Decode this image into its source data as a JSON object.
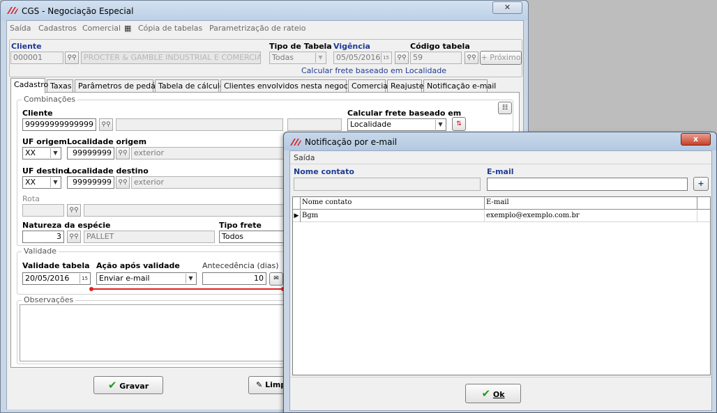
{
  "main_window": {
    "title": "CGS - Negociação Especial",
    "menu": [
      "Saída",
      "Cadastros",
      "Comercial",
      "Cópia de tabelas",
      "Parametrização de rateio"
    ],
    "header": {
      "cliente_label": "Cliente",
      "cliente_code": "000001",
      "cliente_name": "PROCTER & GAMBLE INDUSTRIAL E COMERCIAL LTDA",
      "tipo_tabela_label": "Tipo de Tabela",
      "tipo_tabela_value": "Todas",
      "vigencia_label": "Vigência",
      "vigencia_value": "05/05/2016",
      "codigo_tabela_label": "Código tabela",
      "codigo_tabela_value": "59",
      "proximo_label": "Próximo",
      "info_text": "Calcular frete baseado em Localidade"
    },
    "tabs": [
      "Cadastro",
      "Taxas",
      "Parâmetros de pedágio",
      "Tabela de cálculo",
      "Clientes envolvidos nesta negociação",
      "Comercial",
      "Reajuste",
      "Notificação e-mail"
    ],
    "combinacoes": {
      "title": "Combinações",
      "cliente_label": "Cliente",
      "cliente_value": "99999999999999",
      "calc_label": "Calcular frete baseado em",
      "calc_value": "Localidade",
      "uf_origem_label": "UF origem",
      "uf_origem_value": "XX",
      "loc_origem_label": "Localidade origem",
      "loc_origem_code": "99999999",
      "loc_origem_name": "exterior",
      "uf_destino_label": "UF destino",
      "uf_destino_value": "XX",
      "loc_destino_label": "Localidade destino",
      "loc_destino_code": "99999999",
      "loc_destino_name": "exterior",
      "rota_label": "Rota",
      "natureza_label": "Natureza da espécie",
      "natureza_code": "3",
      "natureza_name": "PALLET",
      "tipo_frete_label": "Tipo frete",
      "tipo_frete_value": "Todos"
    },
    "validade": {
      "title": "Validade",
      "validade_tabela_label": "Validade tabela",
      "validade_tabela_value": "20/05/2016",
      "acao_label": "Ação após validade",
      "acao_value": "Enviar e-mail",
      "antecedencia_label": "Antecedência (dias)",
      "antecedencia_value": "10"
    },
    "observacoes_title": "Observações",
    "buttons": {
      "gravar": "Gravar",
      "limpar": "Limp"
    }
  },
  "dialog": {
    "title": "Notificação por e-mail",
    "menu": [
      "Saída"
    ],
    "nome_contato_label": "Nome contato",
    "email_label": "E-mail",
    "grid_headers": [
      "Nome contato",
      "E-mail"
    ],
    "rows": [
      {
        "nome": "Bgm",
        "email": "exemplo@exemplo.com.br"
      }
    ],
    "ok_label": "Ok",
    "close_label": "x"
  },
  "colors": {
    "accent_blue": "#1f3a93",
    "validation_red": "#e02020",
    "ok_green": "#1d9b1d"
  }
}
